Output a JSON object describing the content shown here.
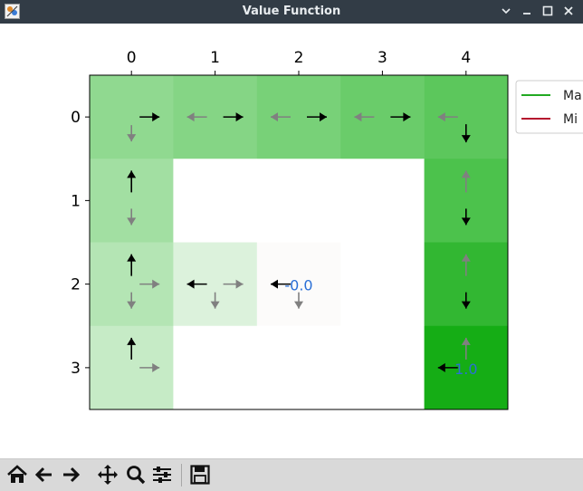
{
  "window": {
    "title": "Value Function",
    "buttons": [
      "minimize-icon",
      "restore-icon",
      "maximize-icon",
      "close-icon"
    ]
  },
  "toolbar": {
    "tools": [
      "home-icon",
      "back-arrow-icon",
      "forward-arrow-icon",
      "pan-icon",
      "zoom-icon",
      "configure-subplots-icon",
      "save-icon"
    ]
  },
  "chart_data": {
    "type": "heatmap",
    "rows": 4,
    "cols": 5,
    "x_ticks": [
      "0",
      "1",
      "2",
      "3",
      "4"
    ],
    "y_ticks": [
      "0",
      "1",
      "2",
      "3"
    ],
    "cell_colors": [
      [
        "#90d990",
        "#85d585",
        "#78d178",
        "#6acc6a",
        "#5cc75c"
      ],
      [
        "#a2dfa2",
        "#ffffff",
        "#ffffff",
        "#ffffff",
        "#4cc24c"
      ],
      [
        "#b4e5b4",
        "#dcf2dc",
        "#fcfbfa",
        "#ffffff",
        "#32b732"
      ],
      [
        "#c6ebc6",
        "#ffffff",
        "#ffffff",
        "#ffffff",
        "#15ad15"
      ]
    ],
    "cell_values": [
      {
        "row": 2,
        "col": 2,
        "text": "-0.0"
      },
      {
        "row": 3,
        "col": 4,
        "text": "1.0"
      }
    ],
    "arrows": [
      {
        "row": 0,
        "col": 0,
        "dir": "right",
        "color": "black"
      },
      {
        "row": 0,
        "col": 0,
        "dir": "down",
        "color": "gray"
      },
      {
        "row": 0,
        "col": 1,
        "dir": "left",
        "color": "gray"
      },
      {
        "row": 0,
        "col": 1,
        "dir": "right",
        "color": "black"
      },
      {
        "row": 0,
        "col": 2,
        "dir": "left",
        "color": "gray"
      },
      {
        "row": 0,
        "col": 2,
        "dir": "right",
        "color": "black"
      },
      {
        "row": 0,
        "col": 3,
        "dir": "left",
        "color": "gray"
      },
      {
        "row": 0,
        "col": 3,
        "dir": "right",
        "color": "black"
      },
      {
        "row": 0,
        "col": 4,
        "dir": "left",
        "color": "gray"
      },
      {
        "row": 0,
        "col": 4,
        "dir": "down",
        "color": "black"
      },
      {
        "row": 1,
        "col": 0,
        "dir": "up",
        "color": "black"
      },
      {
        "row": 1,
        "col": 0,
        "dir": "down",
        "color": "gray"
      },
      {
        "row": 1,
        "col": 4,
        "dir": "up",
        "color": "gray"
      },
      {
        "row": 1,
        "col": 4,
        "dir": "down",
        "color": "black"
      },
      {
        "row": 2,
        "col": 0,
        "dir": "up",
        "color": "black"
      },
      {
        "row": 2,
        "col": 0,
        "dir": "right",
        "color": "gray"
      },
      {
        "row": 2,
        "col": 0,
        "dir": "down",
        "color": "gray"
      },
      {
        "row": 2,
        "col": 1,
        "dir": "left",
        "color": "black"
      },
      {
        "row": 2,
        "col": 1,
        "dir": "right",
        "color": "gray"
      },
      {
        "row": 2,
        "col": 1,
        "dir": "down",
        "color": "gray"
      },
      {
        "row": 2,
        "col": 2,
        "dir": "left",
        "color": "black"
      },
      {
        "row": 2,
        "col": 2,
        "dir": "down",
        "color": "gray"
      },
      {
        "row": 2,
        "col": 4,
        "dir": "up",
        "color": "gray"
      },
      {
        "row": 2,
        "col": 4,
        "dir": "down",
        "color": "black"
      },
      {
        "row": 3,
        "col": 0,
        "dir": "up",
        "color": "black"
      },
      {
        "row": 3,
        "col": 0,
        "dir": "right",
        "color": "gray"
      },
      {
        "row": 3,
        "col": 4,
        "dir": "left",
        "color": "black"
      },
      {
        "row": 3,
        "col": 4,
        "dir": "up",
        "color": "gray"
      }
    ],
    "legend": {
      "position": "outside-top-right",
      "entries": [
        {
          "label": "Ma",
          "color": "#22aa22"
        },
        {
          "label": "Mi",
          "color": "#b5122e"
        }
      ]
    },
    "colors": {
      "arrow_black": "#000000",
      "arrow_gray": "#808080",
      "value_text": "#2a6fd6"
    }
  }
}
